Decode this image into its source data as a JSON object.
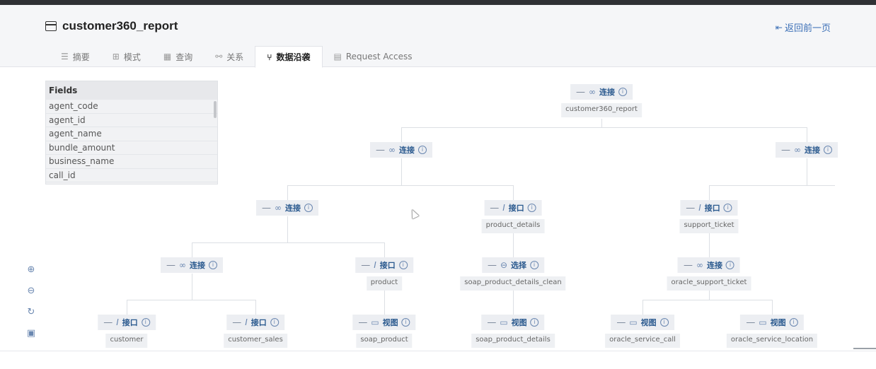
{
  "header": {
    "title": "customer360_report",
    "back_label": "返回前一页"
  },
  "tabs": [
    {
      "label": "摘要",
      "icon": "list-icon"
    },
    {
      "label": "模式",
      "icon": "hierarchy-icon"
    },
    {
      "label": "查询",
      "icon": "table-icon"
    },
    {
      "label": "关系",
      "icon": "link-icon"
    },
    {
      "label": "数据沿袭",
      "icon": "lineage-icon",
      "active": true
    },
    {
      "label": "Request Access",
      "icon": "document-icon"
    }
  ],
  "fields": {
    "header": "Fields",
    "items": [
      "agent_code",
      "agent_id",
      "agent_name",
      "bundle_amount",
      "business_name",
      "call_id"
    ]
  },
  "graph": {
    "n_root": {
      "type": "连接",
      "name": "customer360_report"
    },
    "n_a": {
      "type": "连接"
    },
    "n_b": {
      "type": "连接"
    },
    "n_c": {
      "type": "连接"
    },
    "n_d": {
      "type": "接口",
      "name": "product_details"
    },
    "n_e": {
      "type": "接口",
      "name": "support_ticket"
    },
    "n_f": {
      "type": "连接"
    },
    "n_g": {
      "type": "接口",
      "name": "product"
    },
    "n_h": {
      "type": "选择",
      "name": "soap_product_details_clean"
    },
    "n_i": {
      "type": "连接",
      "name": "oracle_support_ticket"
    },
    "n_j": {
      "type": "接口",
      "name": "customer"
    },
    "n_k": {
      "type": "接口",
      "name": "customer_sales"
    },
    "n_l": {
      "type": "视图",
      "name": "soap_product"
    },
    "n_m": {
      "type": "视图",
      "name": "soap_product_details"
    },
    "n_n": {
      "type": "视图",
      "name": "oracle_service_call"
    },
    "n_o": {
      "type": "视图",
      "name": "oracle_service_location"
    }
  },
  "colors": {
    "accent": "#3b6fb6",
    "node_text": "#2b5a8f"
  }
}
